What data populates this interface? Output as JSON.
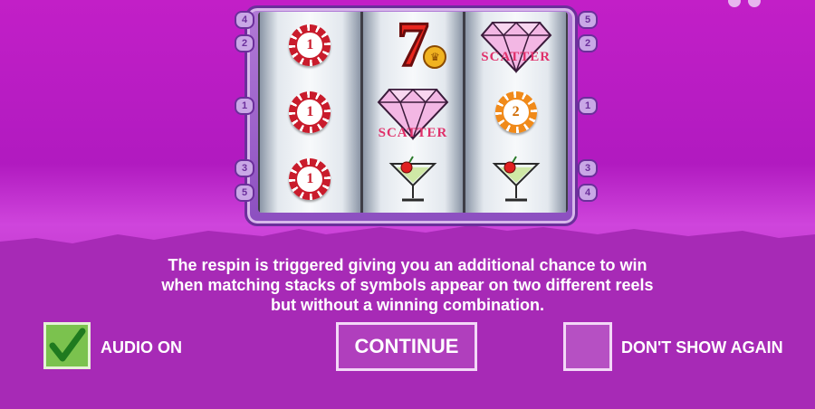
{
  "game": {
    "reels": [
      {
        "symbols": [
          "chip-1",
          "chip-1",
          "chip-1"
        ]
      },
      {
        "symbols": [
          "seven",
          "diamond-scatter",
          "martini"
        ]
      },
      {
        "symbols": [
          "diamond-scatter",
          "chip-2",
          "martini"
        ]
      }
    ],
    "chip_values": {
      "a": "1",
      "b": "1",
      "c": "1",
      "d": "2"
    },
    "seven_text": "7",
    "scatter_text": "SCATTER",
    "left_paylines": [
      "4",
      "2",
      "1",
      "3",
      "5"
    ],
    "right_paylines": [
      "5",
      "2",
      "1",
      "3",
      "4"
    ]
  },
  "dialog": {
    "message_line1": "The respin is triggered giving you an additional chance to win",
    "message_line2": "when matching stacks of symbols appear on two different reels",
    "message_line3": "but without a winning combination.",
    "audio_label": "AUDIO ON",
    "audio_checked": true,
    "continue_label": "CONTINUE",
    "dont_show_label": "DON'T SHOW AGAIN",
    "dont_show_checked": false
  },
  "colors": {
    "background": "#c21fc7",
    "checkbox_checked": "#7bc24e",
    "chip_red": "#c91c2c",
    "chip_orange": "#f08a1a",
    "scatter_text": "#e0306a"
  }
}
